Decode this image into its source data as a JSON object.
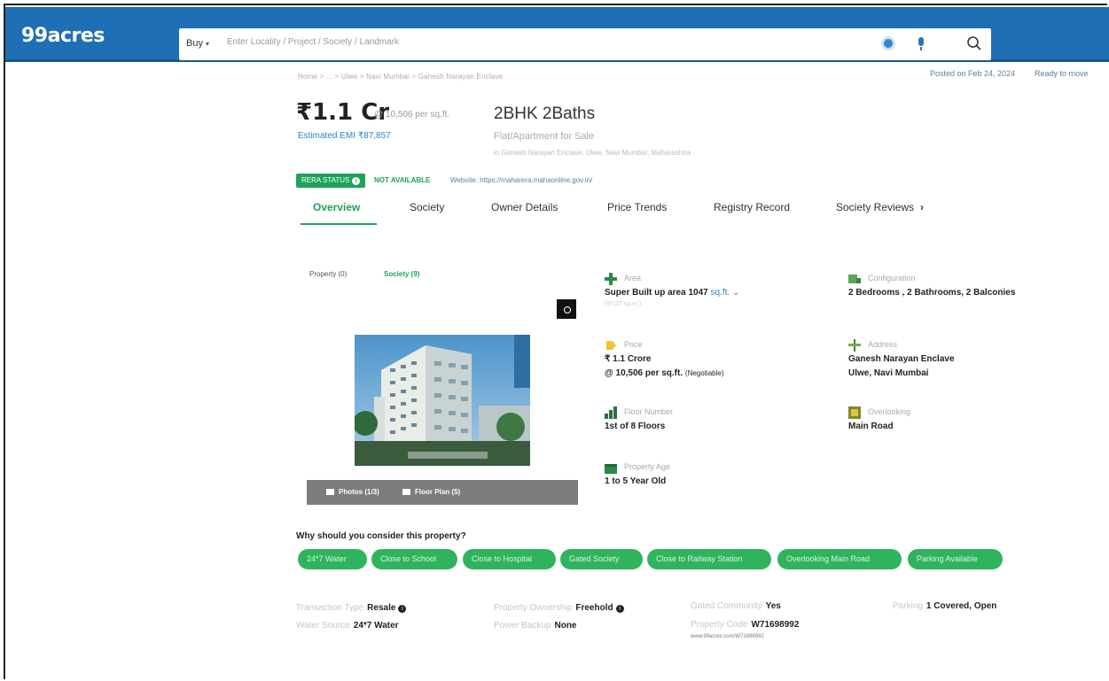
{
  "header": {
    "logo": "99acres",
    "search": {
      "buy_label": "Buy",
      "placeholder": "Enter Locality / Project / Society / Landmark"
    }
  },
  "meta": {
    "breadcrumb": "Home > ... > Ulwe > Navi Mumbai > Ganesh Narayan Enclave",
    "posted": "Posted on Feb 24, 2024",
    "status": "Ready to move"
  },
  "listing": {
    "price": "₹1.1 Cr",
    "price_per_sqft": "@ 10,506 per sq.ft.",
    "emi": "Estimated EMI ₹87,857",
    "title": "2BHK 2Baths",
    "type": "Flat/Apartment for Sale",
    "address": "in Ganesh Narayan Enclave, Ulwe, Navi Mumbai, Maharashtra",
    "rera_status": "RERA STATUS",
    "rera_value": "NOT AVAILABLE",
    "rera_website": "Website: https://maharera.mahaonline.gov.in/"
  },
  "tabs": [
    {
      "label": "Overview"
    },
    {
      "label": "Society"
    },
    {
      "label": "Owner Details"
    },
    {
      "label": "Price Trends"
    },
    {
      "label": "Registry Record"
    },
    {
      "label": "Society Reviews"
    }
  ],
  "media": {
    "toggle_property": "Property (0)",
    "toggle_society": "Society (9)",
    "photos": "Photos (1/3)",
    "floor_plan": "Floor Plan (5)"
  },
  "specs": {
    "area": {
      "label": "Area",
      "value": "Super Built up area 1047",
      "unit": "sq.ft.",
      "sub": "(97.27 sq.m.)"
    },
    "configuration": {
      "label": "Configuration",
      "value": "2 Bedrooms , 2 Bathrooms, 2 Balconies"
    },
    "price": {
      "label": "Price",
      "value": "₹ 1.1 Crore",
      "value2": "@ 10,506 per sq.ft.",
      "note": "(Negotiable)"
    },
    "address": {
      "label": "Address",
      "value": "Ganesh Narayan Enclave",
      "value2": "Ulwe, Navi Mumbai"
    },
    "floor": {
      "label": "Floor Number",
      "value": "1st of 8 Floors"
    },
    "overlooking": {
      "label": "Overlooking",
      "value": "Main Road"
    },
    "age": {
      "label": "Property Age",
      "value": "1 to 5 Year Old"
    }
  },
  "why": {
    "title": "Why should you consider this property?",
    "chips": [
      "24*7 Water",
      "Close to School",
      "Close to Hospital",
      "Gated Society",
      "Close to Railway Station",
      "Overlooking Main Road",
      "Parking Available"
    ]
  },
  "attributes": {
    "transaction": {
      "label": "Transaction Type",
      "value": "Resale"
    },
    "ownership": {
      "label": "Property Ownership",
      "value": "Freehold"
    },
    "gated": {
      "label": "Gated Community",
      "value": "Yes"
    },
    "parking": {
      "label": "Parking",
      "value": "1 Covered, Open"
    },
    "water": {
      "label": "Water Source",
      "value": "24*7 Water"
    },
    "power": {
      "label": "Power Backup",
      "value": "None"
    },
    "property_code": {
      "label": "Property Code",
      "value": "W71698992"
    },
    "url": "www.99acres.com/W71698992"
  },
  "colors": {
    "brand_blue": "#1f6fb4",
    "accent_green": "#1da35a",
    "chip_green": "#2fb45d"
  }
}
